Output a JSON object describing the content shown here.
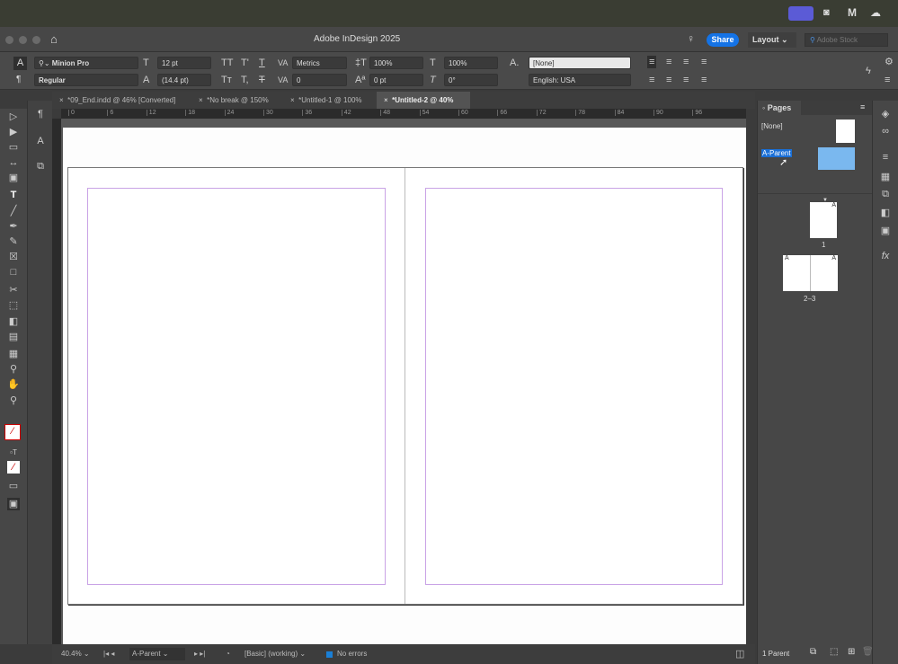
{
  "app": {
    "title": "Adobe InDesign 2025",
    "share": "Share",
    "workspace": "Layout",
    "stock_placeholder": "Adobe Stock"
  },
  "control": {
    "font": "Minion Pro",
    "style": "Regular",
    "size": "12 pt",
    "leading": "(14.4 pt)",
    "kerning": "Metrics",
    "tracking": "0",
    "vscale": "100%",
    "hscale": "100%",
    "baseline": "0 pt",
    "skew": "0°",
    "char_style": "[None]",
    "language": "English: USA"
  },
  "tabs": [
    {
      "label": "*09_End.indd @ 46% [Converted]"
    },
    {
      "label": "*No break @ 150%"
    },
    {
      "label": "*Untitled-1 @ 100%"
    },
    {
      "label": "*Untitled-2 @ 40%"
    }
  ],
  "ruler": {
    "ticks": [
      "0",
      "6",
      "12",
      "18",
      "24",
      "30",
      "36",
      "42",
      "48",
      "54",
      "60",
      "66",
      "72",
      "78",
      "84",
      "90",
      "96"
    ]
  },
  "status": {
    "zoom": "40.4%",
    "page": "A-Parent",
    "preflight_profile": "[Basic] (working)",
    "errors": "No errors"
  },
  "pages_panel": {
    "title": "Pages",
    "parents": [
      {
        "label": "[None]"
      },
      {
        "label": "A-Parent"
      }
    ],
    "pages": [
      {
        "label": "1",
        "prefix": "A"
      },
      {
        "label": "2–3",
        "prefix": "A"
      }
    ],
    "footer": "1 Parent"
  }
}
